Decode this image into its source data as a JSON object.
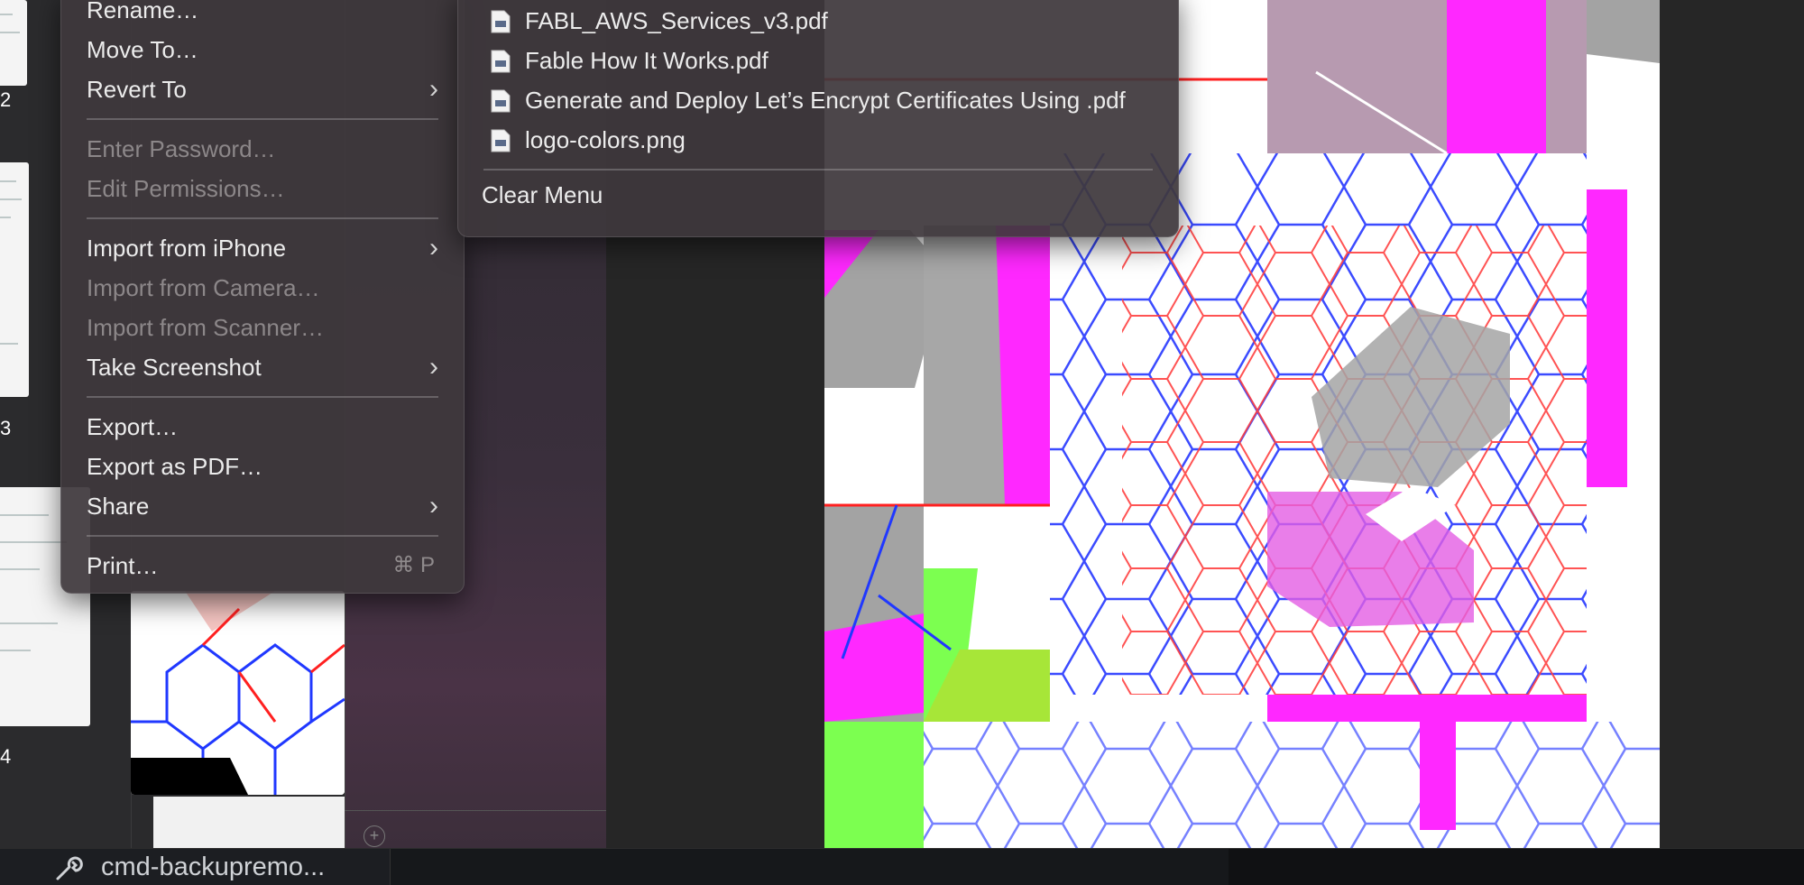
{
  "file_menu": {
    "items": [
      {
        "label": "Rename…",
        "enabled": true
      },
      {
        "label": "Move To…",
        "enabled": true
      },
      {
        "label": "Revert To",
        "enabled": true,
        "submenu": true
      },
      {
        "label": "Enter Password…",
        "enabled": false
      },
      {
        "label": "Edit Permissions…",
        "enabled": false
      },
      {
        "label": "Import from iPhone",
        "enabled": true,
        "submenu": true
      },
      {
        "label": "Import from Camera…",
        "enabled": false
      },
      {
        "label": "Import from Scanner…",
        "enabled": false
      },
      {
        "label": "Take Screenshot",
        "enabled": true,
        "submenu": true
      },
      {
        "label": "Export…",
        "enabled": true
      },
      {
        "label": "Export as PDF…",
        "enabled": true
      },
      {
        "label": "Share",
        "enabled": true,
        "submenu": true
      },
      {
        "label": "Print…",
        "enabled": true,
        "shortcut": "⌘ P"
      }
    ],
    "submenu_chevron": "›"
  },
  "recent_submenu": {
    "files": [
      {
        "name": "FABL_AWS_Services_v3.pdf",
        "icon": "pdf-document-icon"
      },
      {
        "name": "Fable How It Works.pdf",
        "icon": "pdf-document-icon"
      },
      {
        "name": "Generate and Deploy Let’s Encrypt Certificates Using .pdf",
        "icon": "pdf-document-icon"
      },
      {
        "name": "logo-colors.png",
        "icon": "image-document-icon"
      }
    ],
    "clear_label": "Clear Menu"
  },
  "thumbnail_strip": {
    "page_numbers": [
      "2",
      "3",
      "4"
    ]
  },
  "sidebar": {
    "add_symbol": "+"
  },
  "taskbar": {
    "tab_label": "cmd-backupremo..."
  },
  "colors": {
    "menu_bg": "#3e383c",
    "magenta": "#ff28ff",
    "hex_blue": "#2c3cff",
    "hex_red": "#ff3030",
    "lime": "#7cff50",
    "grey": "#a3a3a3"
  }
}
